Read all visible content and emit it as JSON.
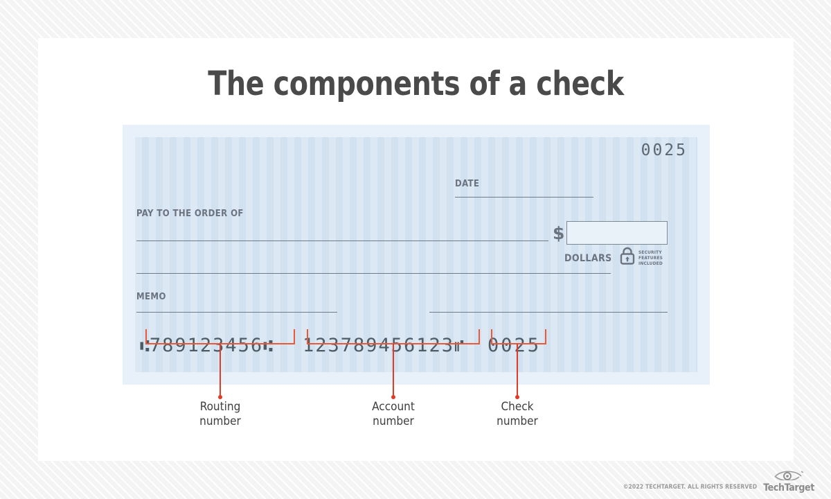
{
  "page": {
    "title": "The components of a check"
  },
  "check": {
    "check_number_top": "0025",
    "date_label": "DATE",
    "pay_to_label": "PAY TO THE\nORDER OF",
    "currency_symbol": "$",
    "amount_value": "",
    "dollars_label": "DOLLARS",
    "memo_label": "MEMO",
    "security_badge": {
      "icon": "lock-icon",
      "line1": "SECURITY",
      "line2": "FEATURES",
      "line3": "INCLUDED"
    },
    "micr": {
      "routing_symbol_left": "⑆",
      "routing_digits": "789123456",
      "routing_symbol_right": "⑆",
      "account_digits": "123789456123",
      "account_symbol_right": "⑈",
      "check_digits": "0025"
    }
  },
  "callouts": [
    {
      "label": "Routing\nnumber"
    },
    {
      "label": "Account\nnumber"
    },
    {
      "label": "Check\nnumber"
    }
  ],
  "footer": {
    "copyright": "©2022 TECHTARGET. ALL RIGHTS RESERVED",
    "logo_text": "TechTarget",
    "logo_icon": "eye-icon"
  },
  "colors": {
    "accent": "#e03b24",
    "title": "#4a4a4a",
    "check_bg": "#dbe8f3",
    "check_frame": "#e8f1f9"
  }
}
